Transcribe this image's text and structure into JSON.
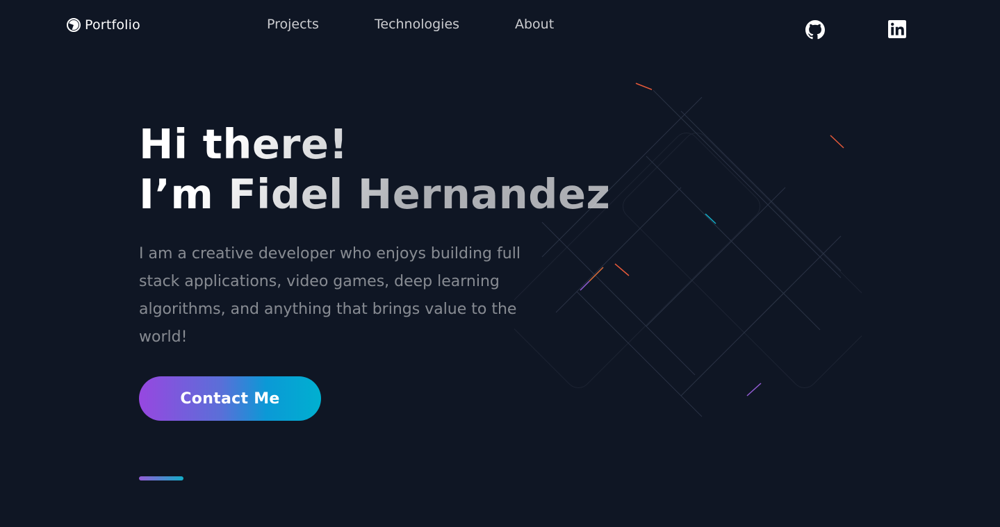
{
  "header": {
    "logo_label": "Portfolio",
    "nav": [
      {
        "label": "Projects"
      },
      {
        "label": "Technologies"
      },
      {
        "label": "About"
      }
    ],
    "social": [
      {
        "icon": "github-icon"
      },
      {
        "icon": "linkedin-icon"
      }
    ]
  },
  "hero": {
    "title_line1": "Hi there!",
    "title_line2": "I’m Fidel Hernandez",
    "description": "I am a creative developer who enjoys building full stack applications, video games, deep learning algorithms, and anything that brings value to the world!",
    "cta_label": "Contact Me"
  },
  "colors": {
    "background": "#0f1624",
    "cta_gradient_start": "#9747e0",
    "cta_gradient_end": "#00b0d0",
    "divider_gradient_start": "#945dd6",
    "divider_gradient_end": "#13adc7"
  }
}
